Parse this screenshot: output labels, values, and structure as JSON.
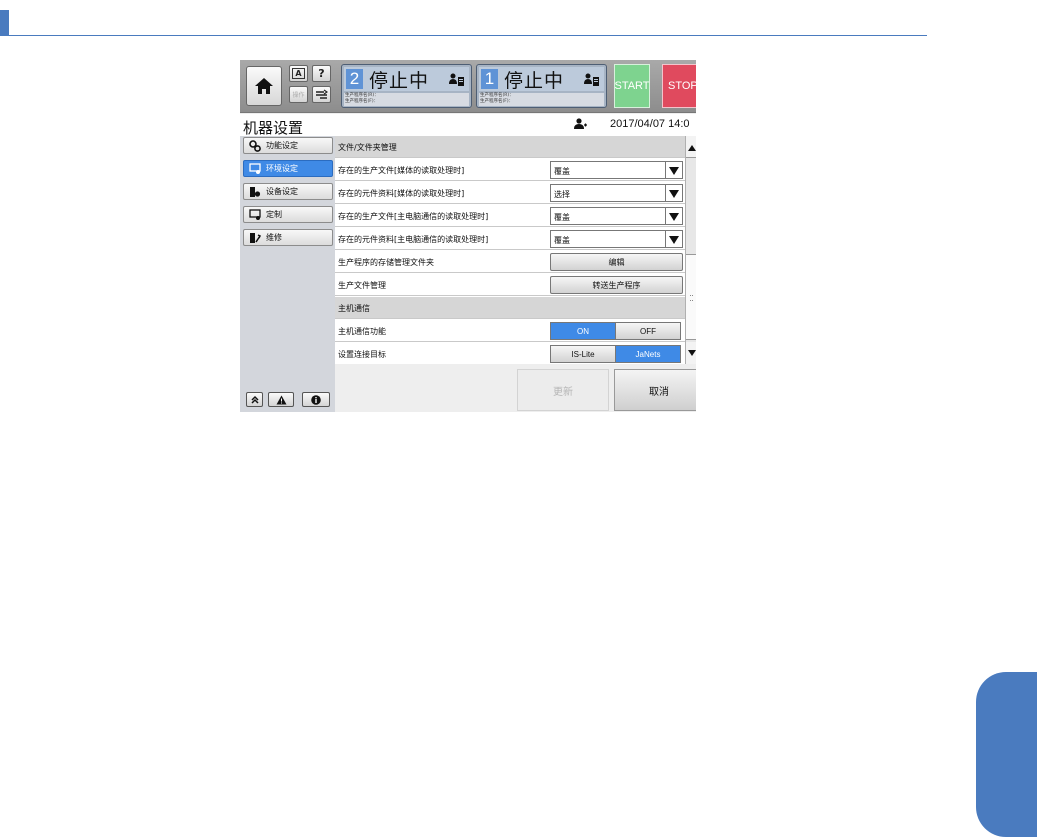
{
  "topbar": {
    "mini_buttons": {
      "keyboard_label": "A",
      "help_label": "?",
      "faded_label": "操作"
    },
    "lanes": [
      {
        "number": "2",
        "status": "停止中",
        "line1": "生产程序名(R)：",
        "line2": "生产程序名(F)："
      },
      {
        "number": "1",
        "status": "停止中",
        "line1": "生产程序名(R)：",
        "line2": "生产程序名(F)："
      }
    ],
    "start_label": "START",
    "stop_label": "STOP"
  },
  "header": {
    "title": "机器设置",
    "datetime": "2017/04/07 14:0"
  },
  "sidebar": {
    "items": [
      {
        "label": "功能设定",
        "icon": "gears-icon",
        "active": false
      },
      {
        "label": "环境设定",
        "icon": "monitor-gear-icon",
        "active": true
      },
      {
        "label": "设备设定",
        "icon": "machine-gear-icon",
        "active": false
      },
      {
        "label": "定制",
        "icon": "monitor-gear-icon",
        "active": false
      },
      {
        "label": "维修",
        "icon": "maintenance-icon",
        "active": false
      }
    ],
    "bottom_buttons": [
      "double-chevron-up-icon",
      "warning-icon",
      "info-icon"
    ]
  },
  "settings": {
    "section_file": "文件/文件夹管理",
    "rows": {
      "prod_file_media": {
        "label": "存在的生产文件[媒体的读取处理时]",
        "value": "覆盖"
      },
      "parts_data_media": {
        "label": "存在的元件资料[媒体的读取处理时]",
        "value": "选择"
      },
      "prod_file_host": {
        "label": "存在的生产文件[主电脑通信的读取处理时]",
        "value": "覆盖"
      },
      "parts_data_host": {
        "label": "存在的元件资料[主电脑通信的读取处理时]",
        "value": "覆盖"
      },
      "storage_folder": {
        "label": "生产程序的存储管理文件夹",
        "button": "编辑"
      },
      "prod_file_mgmt": {
        "label": "生产文件管理",
        "button": "转送生产程序"
      }
    },
    "section_host": "主机通信",
    "host_function": {
      "label": "主机通信功能",
      "on": "ON",
      "off": "OFF",
      "selected": "ON"
    },
    "connect_target": {
      "label": "设置连接目标",
      "option1": "IS-Lite",
      "option2": "JaNets",
      "selected": "JaNets"
    }
  },
  "footer": {
    "update_label": "更新",
    "cancel_label": "取消"
  },
  "colors": {
    "accent_blue": "#3f8ae6",
    "doc_blue": "#4a7bbf",
    "start_green": "#7ed38f",
    "stop_red": "#e04a5e"
  }
}
